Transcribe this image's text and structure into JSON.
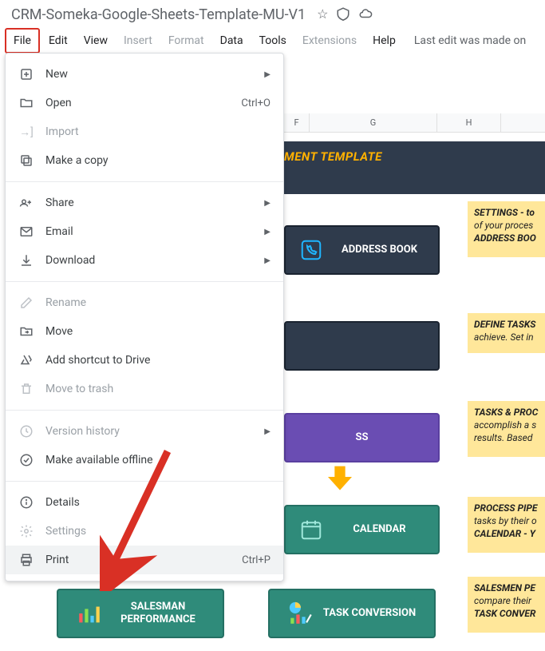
{
  "doc": {
    "title": "CRM-Someka-Google-Sheets-Template-MU-V1"
  },
  "menubar": {
    "file": "File",
    "edit": "Edit",
    "view": "View",
    "insert": "Insert",
    "format": "Format",
    "data": "Data",
    "tools": "Tools",
    "extensions": "Extensions",
    "help": "Help",
    "lastEdit": "Last edit was made on"
  },
  "dropdown": {
    "new": "New",
    "open": "Open",
    "openShortcut": "Ctrl+O",
    "import": "Import",
    "makeCopy": "Make a copy",
    "share": "Share",
    "email": "Email",
    "download": "Download",
    "rename": "Rename",
    "move": "Move",
    "addShortcut": "Add shortcut to Drive",
    "trash": "Move to trash",
    "versionHistory": "Version history",
    "offline": "Make available offline",
    "details": "Details",
    "settings": "Settings",
    "print": "Print",
    "printShortcut": "Ctrl+P"
  },
  "sheet": {
    "cols": {
      "f": "F",
      "g": "G",
      "h": "H"
    },
    "headerTitle": "MENT TEMPLATE",
    "tiles": {
      "addressBook": "ADDRESS BOOK",
      "tasksProcess": "SS",
      "calendar": "CALENDAR",
      "salesman": "SALESMAN PERFORMANCE",
      "taskConversion": "TASK CONVERSION"
    },
    "notes": {
      "n1a": "SETTINGS - to",
      "n1b": "of your proces",
      "n1c": "ADDRESS BOO",
      "n2a": "DEFINE TASKS",
      "n2b": "achieve. Set in",
      "n3a": "TASKS & PROC",
      "n3b": "accomplish a s",
      "n3c": "results. Based",
      "n4a": "PROCESS PIPE",
      "n4b": "tasks by their o",
      "n4c": "CALENDAR -  Y",
      "n5a": "SALESMEN PE",
      "n5b": "compare their",
      "n5c": "TASK CONVER"
    }
  }
}
